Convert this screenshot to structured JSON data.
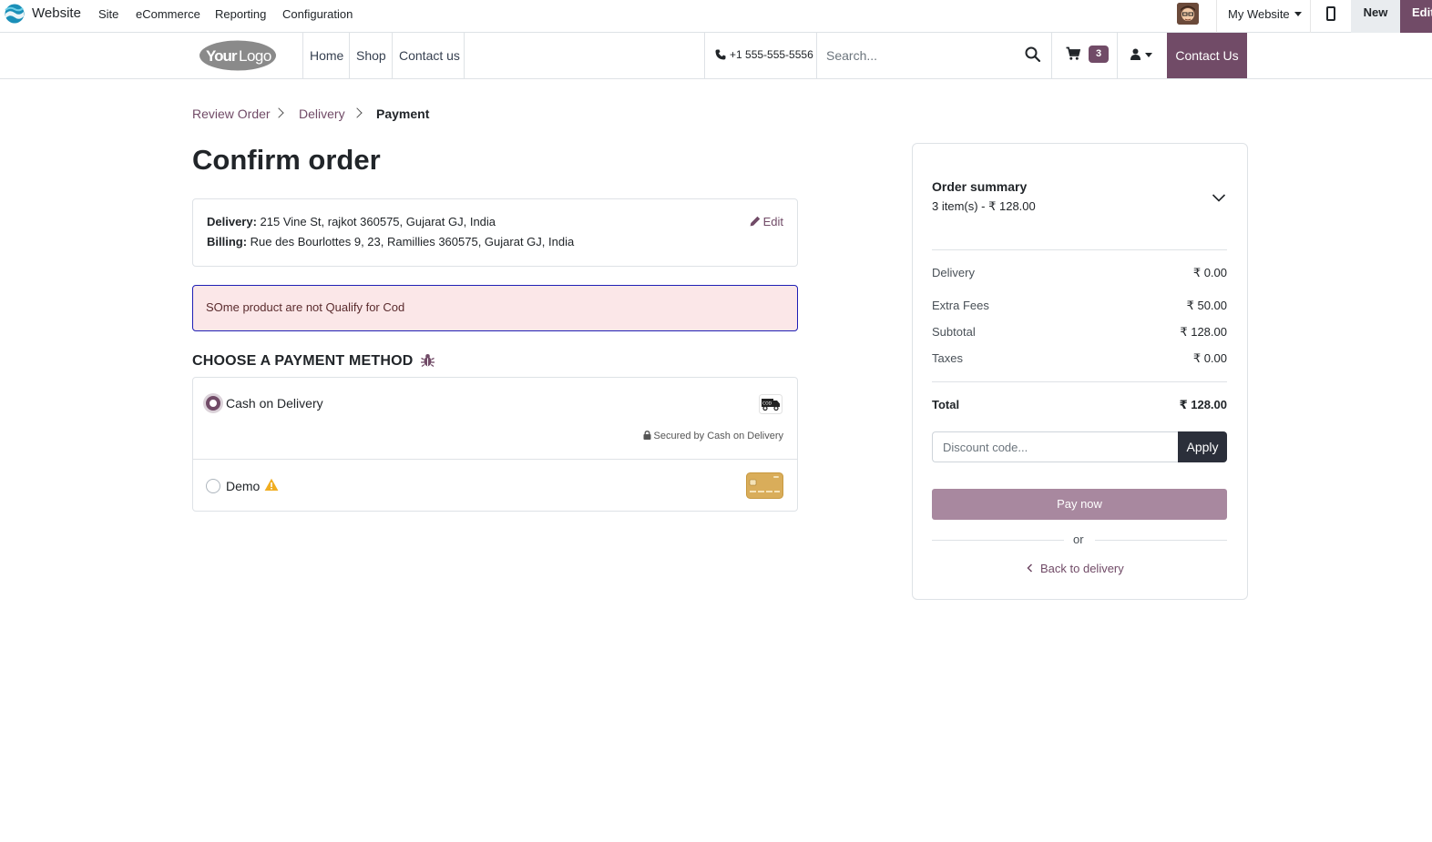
{
  "adminbar": {
    "app_name": "Website",
    "menu": [
      "Site",
      "eCommerce",
      "Reporting",
      "Configuration"
    ],
    "website_selector": "My Website",
    "new_label": "New",
    "edit_label": "Edit"
  },
  "header": {
    "logo_text": "YourLogo",
    "nav": [
      "Home",
      "Shop",
      "Contact us"
    ],
    "phone": "+1 555-555-5556",
    "search_placeholder": "Search...",
    "cart_count": "3",
    "contact_button": "Contact Us"
  },
  "breadcrumb": {
    "items": [
      "Review Order",
      "Delivery",
      "Payment"
    ]
  },
  "page_title": "Confirm order",
  "address": {
    "delivery_label": "Delivery:",
    "delivery_value": "215 Vine St, rajkot 360575, Gujarat GJ, India",
    "billing_label": "Billing:",
    "billing_value": "Rue des Bourlottes 9, 23, Ramillies 360575, Gujarat GJ, India",
    "edit_label": "Edit"
  },
  "alert_text": "SOme product are not Qualify for Cod",
  "payment": {
    "title": "CHOOSE A PAYMENT METHOD",
    "methods": [
      {
        "label": "Cash on Delivery",
        "checked": true,
        "secured_text": "Secured by Cash on Delivery"
      },
      {
        "label": "Demo",
        "checked": false
      }
    ]
  },
  "summary": {
    "title": "Order summary",
    "subtitle": "3 item(s) -  ₹ 128.00",
    "rows": [
      {
        "label": "Delivery",
        "value": "₹ 0.00"
      },
      {
        "label": "Extra Fees",
        "value": "₹ 50.00"
      },
      {
        "label": "Subtotal",
        "value": "₹ 128.00"
      },
      {
        "label": "Taxes",
        "value": "₹ 0.00"
      }
    ],
    "total_label": "Total",
    "total_value": "₹ 128.00",
    "discount_placeholder": "Discount code...",
    "apply_label": "Apply",
    "pay_label": "Pay now",
    "or_label": "or",
    "back_label": "Back to delivery"
  },
  "colors": {
    "brand": "#714b67",
    "alert_bg": "#fbe7e8",
    "apply_bg": "#2b2f3a"
  }
}
